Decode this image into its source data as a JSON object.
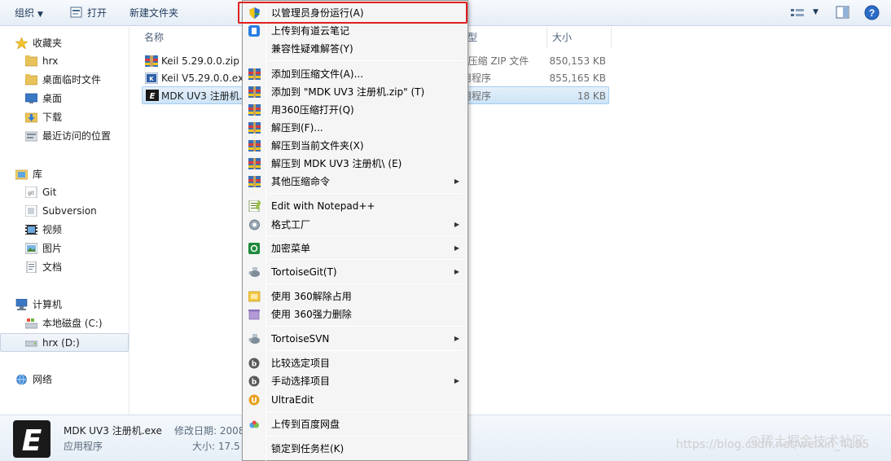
{
  "toolbar": {
    "organize": "组织",
    "open": "打开",
    "new_folder": "新建文件夹"
  },
  "nav": {
    "favorites": "收藏夹",
    "fav_items": [
      "hrx",
      "桌面临时文件",
      "桌面",
      "下载",
      "最近访问的位置"
    ],
    "libraries": "库",
    "lib_items": [
      "Git",
      "Subversion",
      "视频",
      "图片",
      "文档"
    ],
    "computer": "计算机",
    "drives": [
      "本地磁盘 (C:)",
      "hrx (D:)"
    ],
    "network": "网络"
  },
  "columns": {
    "name": "名称",
    "type": "型",
    "size": "大小"
  },
  "files": [
    {
      "name": "Keil 5.29.0.0.zip",
      "type": "0压缩 ZIP 文件",
      "size": "850,153 KB"
    },
    {
      "name": "Keil V5.29.0.0.exe",
      "type": "用程序",
      "size": "855,165 KB"
    },
    {
      "name": "MDK UV3 注册机.",
      "type": "用程序",
      "size": "18 KB"
    }
  ],
  "details": {
    "filename": "MDK UV3 注册机.exe",
    "modified_label": "修改日期: 2008",
    "type": "应用程序",
    "size_label": "大小: 17.5"
  },
  "context_menu": {
    "items": [
      {
        "label": "以管理员身份运行(A)",
        "icon": "shield-icon",
        "submenu": false
      },
      {
        "label": "上传到有道云笔记",
        "icon": "youdao-note-icon",
        "submenu": false
      },
      {
        "label": "兼容性疑难解答(Y)",
        "icon": "",
        "submenu": false
      },
      {
        "label": "添加到压缩文件(A)...",
        "icon": "winrar-icon",
        "submenu": false
      },
      {
        "label": "添加到 \"MDK UV3 注册机.zip\" (T)",
        "icon": "winrar-icon",
        "submenu": false
      },
      {
        "label": "用360压缩打开(Q)",
        "icon": "winrar-icon",
        "submenu": false
      },
      {
        "label": "解压到(F)...",
        "icon": "winrar-icon",
        "submenu": false
      },
      {
        "label": "解压到当前文件夹(X)",
        "icon": "winrar-icon",
        "submenu": false
      },
      {
        "label": "解压到 MDK UV3 注册机\\ (E)",
        "icon": "winrar-icon",
        "submenu": false
      },
      {
        "label": "其他压缩命令",
        "icon": "winrar-icon",
        "submenu": true
      },
      {
        "label": "Edit with Notepad++",
        "icon": "notepad-icon",
        "submenu": false
      },
      {
        "label": "格式工厂",
        "icon": "format-factory-icon",
        "submenu": true
      },
      {
        "label": "加密菜单",
        "icon": "encrypt-icon",
        "submenu": true
      },
      {
        "label": "TortoiseGit(T)",
        "icon": "tortoise-icon",
        "submenu": true
      },
      {
        "label": "使用 360解除占用",
        "icon": "unlock-360-icon",
        "submenu": false
      },
      {
        "label": "使用 360强力删除",
        "icon": "delete-360-icon",
        "submenu": false
      },
      {
        "label": "TortoiseSVN",
        "icon": "tortoise-icon",
        "submenu": true
      },
      {
        "label": "比较选定项目",
        "icon": "compare-icon",
        "submenu": false
      },
      {
        "label": "手动选择项目",
        "icon": "compare-icon",
        "submenu": true
      },
      {
        "label": "UltraEdit",
        "icon": "ultraedit-icon",
        "submenu": false
      },
      {
        "label": "上传到百度网盘",
        "icon": "baidu-cloud-icon",
        "submenu": false
      },
      {
        "label": "锁定到任务栏(K)",
        "icon": "",
        "submenu": false
      }
    ]
  },
  "watermark": {
    "brand": "@稀土掘金技术社区",
    "url": "https://blog.csdn.net/weixin_4195"
  },
  "colors": {
    "highlight_border": "#e02020",
    "menu_background": "#f5f5f5",
    "selection": "#cce4f7"
  }
}
